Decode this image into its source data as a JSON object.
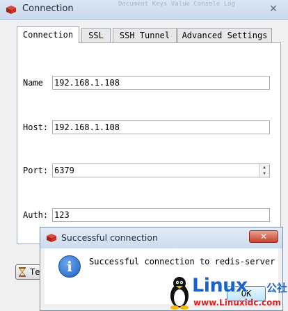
{
  "window": {
    "title": "Connection",
    "close_glyph": "✕",
    "background_ghost_text": "Document   Keys   Value   Console   Log"
  },
  "tabs": [
    {
      "label": "Connection",
      "active": true
    },
    {
      "label": "SSL",
      "active": false
    },
    {
      "label": "SSH Tunnel",
      "active": false
    },
    {
      "label": "Advanced Settings",
      "active": false
    }
  ],
  "form": {
    "name_label": "Name",
    "name_value": "192.168.1.108",
    "host_label": "Host:",
    "host_value": "192.168.1.108",
    "port_label": "Port:",
    "port_value": "6379",
    "auth_label": "Auth:",
    "auth_value": "123"
  },
  "test_button": {
    "label": "Te"
  },
  "dialog": {
    "title": "Successful connection",
    "close_glyph": "✕",
    "message": "Successful connection to redis-server",
    "ok_label": "OK",
    "info_glyph": "i"
  },
  "watermark": {
    "brand": "Linux",
    "brand_cn": "公社",
    "url": "www.Linuxidc.com"
  },
  "colors": {
    "redis_red": "#c8312a",
    "titlebar": "#c9d9ec",
    "watermark_blue": "#1c63c9",
    "watermark_red": "#dd2222"
  }
}
